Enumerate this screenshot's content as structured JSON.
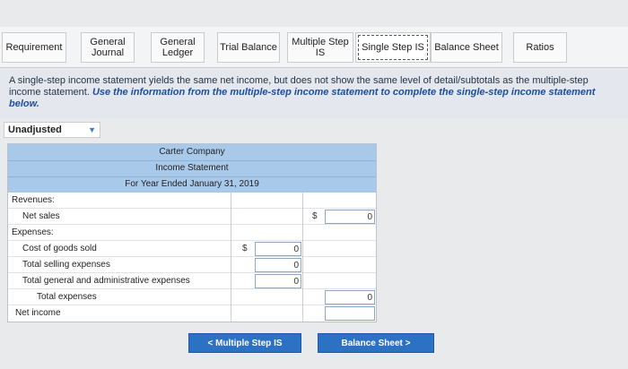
{
  "tabs": [
    {
      "label": "Requirement"
    },
    {
      "label": "General\nJournal"
    },
    {
      "label": "General\nLedger"
    },
    {
      "label": "Trial Balance"
    },
    {
      "label": "Multiple Step\nIS"
    },
    {
      "label": "Single Step IS"
    },
    {
      "label": "Balance Sheet"
    },
    {
      "label": "Ratios"
    }
  ],
  "instruction": {
    "plain": "A single-step income statement yields the same net income, but does not show the same level of detail/subtotals as the multiple-step income statement.",
    "emphasis": "Use the information from the multiple-step income statement to complete the single-step income statement below."
  },
  "dropdown": {
    "selected": "Unadjusted",
    "caret": "▼"
  },
  "statement": {
    "company": "Carter Company",
    "title": "Income Statement",
    "period": "For Year Ended January 31, 2019",
    "rows": {
      "revenues": "Revenues:",
      "net_sales": {
        "label": "Net sales",
        "currency": "$",
        "value": "0"
      },
      "expenses": "Expenses:",
      "cogs": {
        "label": "Cost of goods sold",
        "currency": "$",
        "value": "0"
      },
      "selling": {
        "label": "Total selling expenses",
        "value": "0"
      },
      "gen_admin": {
        "label": "Total general and administrative expenses",
        "value": "0"
      },
      "total_exp": {
        "label": "Total expenses",
        "value": "0"
      },
      "net_income": {
        "label": "Net income"
      }
    }
  },
  "nav": {
    "prev": "<  Multiple Step IS",
    "next": "Balance Sheet  >"
  }
}
